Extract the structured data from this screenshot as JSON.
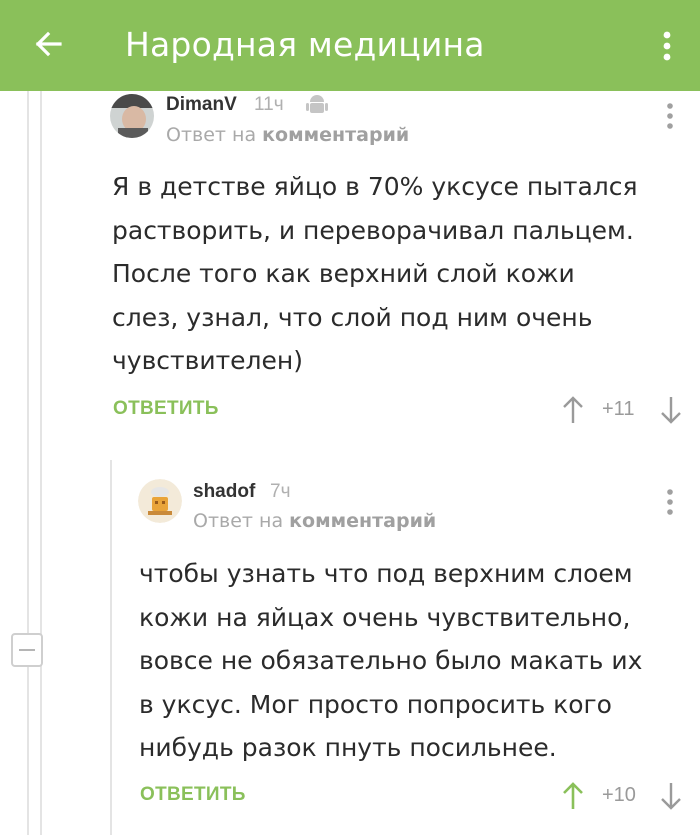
{
  "header": {
    "title": "Народная медицина",
    "background_color": "#8ac05a",
    "back_icon": "arrow-left-icon",
    "menu_icon": "more-vertical-icon"
  },
  "comments": [
    {
      "username": "DimanV",
      "time": "11ч",
      "platform_icon": "android-icon",
      "reply_prefix": "Ответ на",
      "reply_link": "комментарий",
      "text_lines": [
        "Я в детстве яйцо в 70% уксусе пытался",
        "растворить, и переворачивал пальцем.",
        "После того как верхний слой кожи",
        "слез, узнал, что слой под ним очень",
        "чувствителен)"
      ],
      "reply_label": "ОТВЕТИТЬ",
      "score": "+11"
    },
    {
      "username": "shadof",
      "time": "7ч",
      "reply_prefix": "Ответ на",
      "reply_link": "комментарий",
      "text_lines": [
        "чтобы узнать что под верхним слоем",
        "кожи на яйцах очень чувствительно,",
        "вовсе не обязательно было макать их",
        "в уксус. Мог просто попросить кого",
        "нибудь разок пнуть посильнее."
      ],
      "reply_label": "ОТВЕТИТЬ",
      "score": "+10"
    }
  ],
  "colors": {
    "accent": "#8ac05a",
    "upvote_active": "#8ac05a",
    "neutral_icon": "#9a9a9a"
  }
}
